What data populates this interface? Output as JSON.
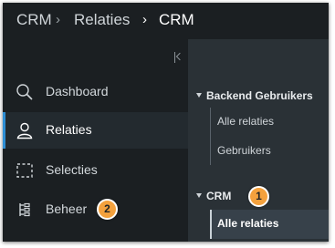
{
  "breadcrumb": [
    "CRM",
    "Relaties",
    "CRM"
  ],
  "sidebar": {
    "items": [
      {
        "label": "Dashboard",
        "icon": "search-icon",
        "active": false
      },
      {
        "label": "Relaties",
        "icon": "user-icon",
        "active": true
      },
      {
        "label": "Selecties",
        "icon": "selection-icon",
        "active": false
      },
      {
        "label": "Beheer",
        "icon": "structure-icon",
        "active": false
      }
    ]
  },
  "panel": {
    "groups": [
      {
        "title": "Backend Gebruikers",
        "items": [
          "Alle relaties",
          "Gebruikers"
        ]
      },
      {
        "title": "CRM",
        "items": [
          "Alle relaties"
        ]
      }
    ]
  },
  "callouts": [
    "1",
    "2"
  ],
  "colors": {
    "background": "#1b1f22",
    "panel": "#2a3136",
    "accent": "#2e8fd5",
    "callout": "#f4a13d"
  }
}
